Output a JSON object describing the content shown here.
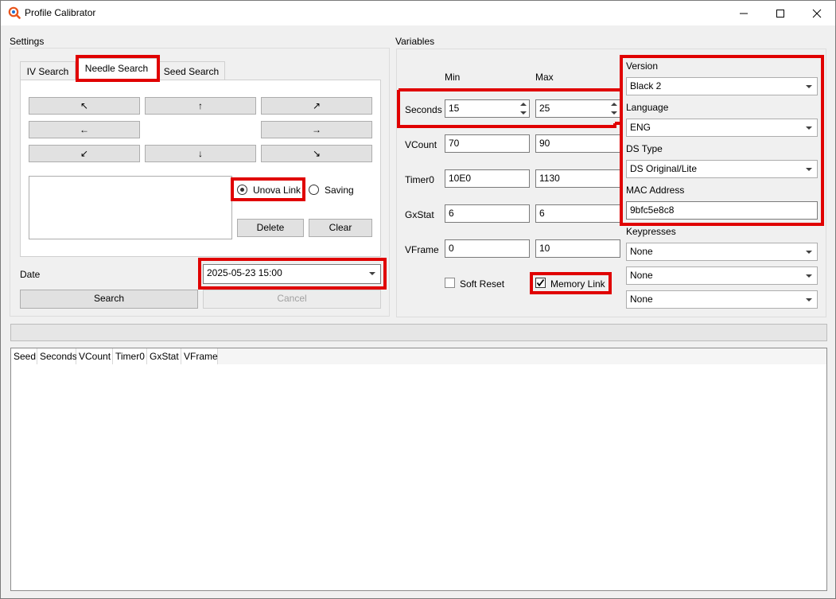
{
  "window": {
    "title": "Profile Calibrator"
  },
  "settings": {
    "group_label": "Settings",
    "tabs": [
      "IV Search",
      "Needle Search",
      "Seed Search"
    ],
    "needles": {
      "up_left": "↖",
      "up": "↑",
      "up_right": "↗",
      "left": "←",
      "right": "→",
      "down_left": "↙",
      "down": "↓",
      "down_right": "↘"
    },
    "unova_link_label": "Unova Link",
    "saving_label": "Saving",
    "delete_label": "Delete",
    "clear_label": "Clear",
    "date_label": "Date",
    "date_value": "2025-05-23 15:00",
    "search_label": "Search",
    "cancel_label": "Cancel"
  },
  "variables": {
    "group_label": "Variables",
    "min_label": "Min",
    "max_label": "Max",
    "rows": [
      {
        "label": "Seconds",
        "min": "15",
        "max": "25"
      },
      {
        "label": "VCount",
        "min": "70",
        "max": "90"
      },
      {
        "label": "Timer0",
        "min": "10E0",
        "max": "1130"
      },
      {
        "label": "GxStat",
        "min": "6",
        "max": "6"
      },
      {
        "label": "VFrame",
        "min": "0",
        "max": "10"
      }
    ],
    "soft_reset_label": "Soft Reset",
    "memory_link_label": "Memory Link",
    "version_label": "Version",
    "version_value": "Black 2",
    "language_label": "Language",
    "language_value": "ENG",
    "ds_type_label": "DS Type",
    "ds_type_value": "DS Original/Lite",
    "mac_label": "MAC Address",
    "mac_value": "9bfc5e8c8",
    "keypresses_label": "Keypresses",
    "keypresses": [
      "None",
      "None",
      "None"
    ]
  },
  "progress": {
    "value": 0
  },
  "results": {
    "columns": [
      "Seed",
      "Seconds",
      "VCount",
      "Timer0",
      "GxStat",
      "VFrame"
    ]
  },
  "colors": {
    "highlight": "#e00000",
    "window_bg": "#f0f0f0"
  }
}
